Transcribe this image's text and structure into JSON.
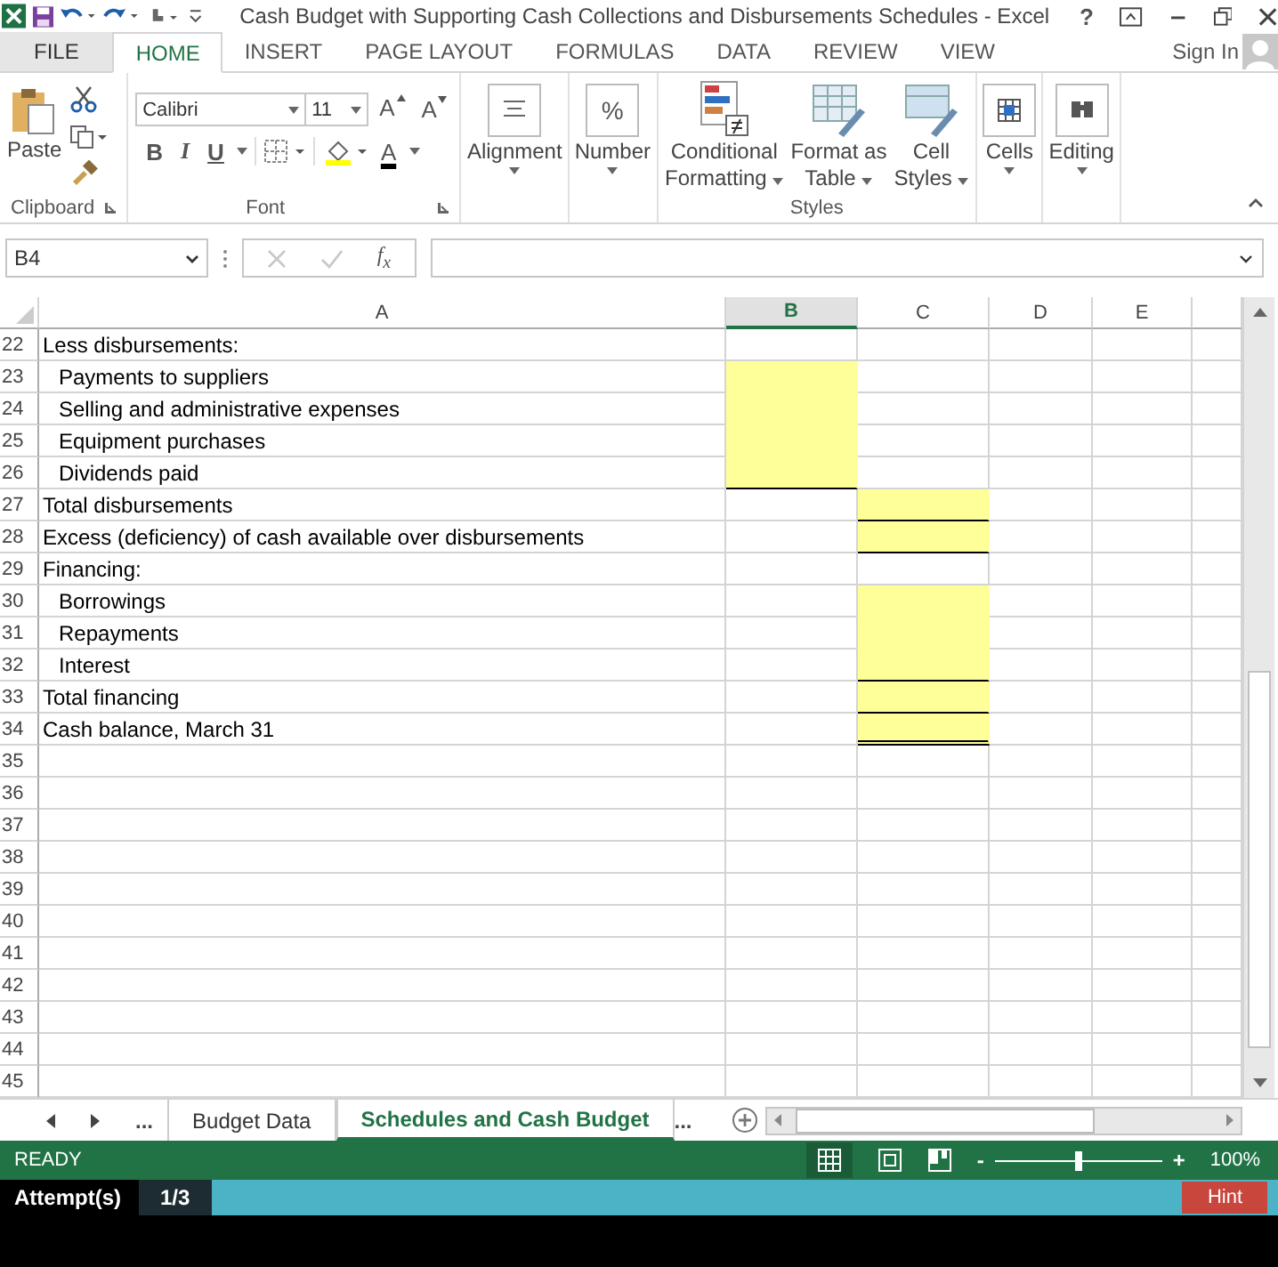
{
  "window": {
    "title": "Cash Budget with Supporting Cash Collections and Disbursements Schedules - Excel",
    "help": "?"
  },
  "ribbon_tabs": [
    {
      "label": "FILE",
      "kind": "file",
      "selected": false
    },
    {
      "label": "HOME",
      "kind": "tab",
      "selected": true
    },
    {
      "label": "INSERT",
      "kind": "tab",
      "selected": false
    },
    {
      "label": "PAGE LAYOUT",
      "kind": "tab",
      "selected": false
    },
    {
      "label": "FORMULAS",
      "kind": "tab",
      "selected": false
    },
    {
      "label": "DATA",
      "kind": "tab",
      "selected": false
    },
    {
      "label": "REVIEW",
      "kind": "tab",
      "selected": false
    },
    {
      "label": "VIEW",
      "kind": "tab",
      "selected": false
    }
  ],
  "sign_in": "Sign In",
  "ribbon": {
    "clipboard": {
      "paste": "Paste",
      "label": "Clipboard"
    },
    "font": {
      "name": "Calibri",
      "size": "11",
      "grow": "A",
      "shrink": "A",
      "bold": "B",
      "italic": "I",
      "underline": "U",
      "font_color_letter": "A",
      "label": "Font"
    },
    "alignment": "Alignment",
    "number": "Number",
    "percent": "%",
    "styles": {
      "conditional": [
        "Conditional",
        "Formatting"
      ],
      "table": [
        "Format as",
        "Table"
      ],
      "cell": [
        "Cell",
        "Styles"
      ],
      "label": "Styles"
    },
    "cells": "Cells",
    "editing": "Editing"
  },
  "formula_bar": {
    "name_box": "B4",
    "fx": "f$_{x}$"
  },
  "columns": [
    {
      "label": "A",
      "selected": false
    },
    {
      "label": "B",
      "selected": true
    },
    {
      "label": "C",
      "selected": false
    },
    {
      "label": "D",
      "selected": false
    },
    {
      "label": "E",
      "selected": false
    }
  ],
  "rows": [
    {
      "num": "22",
      "label": "Less disbursements:",
      "indented": false,
      "b_input": false,
      "b_underlined": false,
      "c_input": false,
      "c_underlined": false,
      "c_double": false
    },
    {
      "num": "23",
      "label": "Payments to suppliers",
      "indented": true,
      "b_input": true,
      "b_underlined": false,
      "c_input": false,
      "c_underlined": false,
      "c_double": false
    },
    {
      "num": "24",
      "label": "Selling and administrative expenses",
      "indented": true,
      "b_input": true,
      "b_underlined": false,
      "c_input": false,
      "c_underlined": false,
      "c_double": false
    },
    {
      "num": "25",
      "label": "Equipment purchases",
      "indented": true,
      "b_input": true,
      "b_underlined": false,
      "c_input": false,
      "c_underlined": false,
      "c_double": false
    },
    {
      "num": "26",
      "label": "Dividends paid",
      "indented": true,
      "b_input": true,
      "b_underlined": true,
      "c_input": false,
      "c_underlined": false,
      "c_double": false
    },
    {
      "num": "27",
      "label": "Total disbursements",
      "indented": false,
      "b_input": false,
      "b_underlined": false,
      "c_input": true,
      "c_underlined": true,
      "c_double": false
    },
    {
      "num": "28",
      "label": "Excess (deficiency) of cash available over disbursements",
      "indented": false,
      "b_input": false,
      "b_underlined": false,
      "c_input": true,
      "c_underlined": true,
      "c_double": false
    },
    {
      "num": "29",
      "label": "Financing:",
      "indented": false,
      "b_input": false,
      "b_underlined": false,
      "c_input": false,
      "c_underlined": false,
      "c_double": false
    },
    {
      "num": "30",
      "label": "Borrowings",
      "indented": true,
      "b_input": false,
      "b_underlined": false,
      "c_input": true,
      "c_underlined": false,
      "c_double": false
    },
    {
      "num": "31",
      "label": "Repayments",
      "indented": true,
      "b_input": false,
      "b_underlined": false,
      "c_input": true,
      "c_underlined": false,
      "c_double": false
    },
    {
      "num": "32",
      "label": "Interest",
      "indented": true,
      "b_input": false,
      "b_underlined": false,
      "c_input": true,
      "c_underlined": true,
      "c_double": false
    },
    {
      "num": "33",
      "label": "Total financing",
      "indented": false,
      "b_input": false,
      "b_underlined": false,
      "c_input": true,
      "c_underlined": true,
      "c_double": false
    },
    {
      "num": "34",
      "label": "Cash balance, March 31",
      "indented": false,
      "b_input": false,
      "b_underlined": false,
      "c_input": true,
      "c_underlined": false,
      "c_double": true
    },
    {
      "num": "35"
    },
    {
      "num": "36"
    },
    {
      "num": "37"
    },
    {
      "num": "38"
    },
    {
      "num": "39"
    },
    {
      "num": "40"
    },
    {
      "num": "41"
    },
    {
      "num": "42"
    },
    {
      "num": "43"
    },
    {
      "num": "44"
    },
    {
      "num": "45"
    }
  ],
  "sheet_tabs": {
    "more_left": "...",
    "tabs": [
      {
        "label": "Budget Data",
        "selected": false
      },
      {
        "label": "Schedules and Cash Budget",
        "selected": true
      }
    ],
    "more_right": "..."
  },
  "status_bar": {
    "status": "READY",
    "zoom": {
      "level": 0.5
    },
    "zoom_out": "-",
    "zoom_in": "+",
    "zoom_value": "100%"
  },
  "attempt_bar": {
    "label": "Attempt(s)",
    "count": "1/3",
    "hint": "Hint"
  }
}
